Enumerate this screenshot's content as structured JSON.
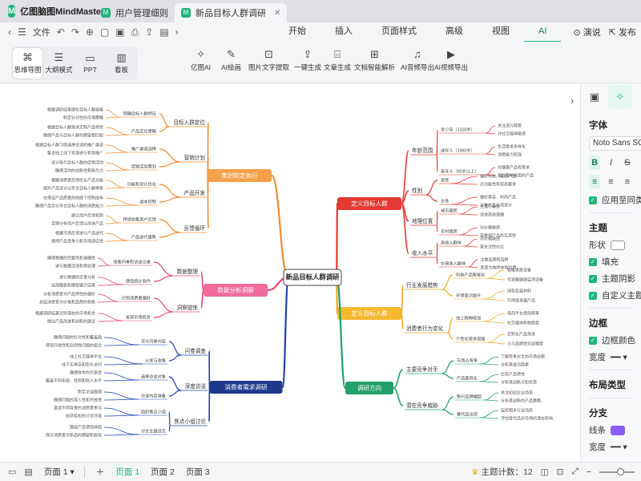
{
  "app": {
    "name": "亿图脑图MindMaster",
    "logo": "M"
  },
  "tabs": [
    {
      "label": "用户管理细则",
      "active": false
    },
    {
      "label": "新品目标人群调研",
      "active": true
    }
  ],
  "menubar": {
    "file_label": "文件",
    "tabs": [
      {
        "label": "开始",
        "active": false
      },
      {
        "label": "插入",
        "active": false
      },
      {
        "label": "页面样式",
        "active": false
      },
      {
        "label": "高级",
        "active": false
      },
      {
        "label": "视图",
        "active": false
      },
      {
        "label": "AI",
        "active": true
      }
    ],
    "present_label": "演说",
    "publish_label": "发布"
  },
  "toolbar": {
    "views": [
      {
        "label": "思维导图",
        "icon": "mindmap-icon",
        "glyph": "⌘",
        "active": true
      },
      {
        "label": "大纲模式",
        "icon": "outline-icon",
        "glyph": "☰",
        "active": false
      },
      {
        "label": "PPT",
        "icon": "ppt-icon",
        "glyph": "▭",
        "active": false
      },
      {
        "label": "看板",
        "icon": "kanban-icon",
        "glyph": "▥",
        "active": false
      }
    ],
    "ai_tools": [
      {
        "label": "亿图AI",
        "glyph": "✧"
      },
      {
        "label": "AI绘画",
        "glyph": "✎"
      },
      {
        "label": "图片文字提取",
        "glyph": "⊡"
      },
      {
        "label": "一键生成",
        "glyph": "⇪"
      },
      {
        "label": "文章生成",
        "glyph": "⌸"
      },
      {
        "label": "文档智能解析",
        "glyph": "⊞"
      },
      {
        "label": "AI音频导出",
        "glyph": "♫"
      },
      {
        "label": "AI视频导出",
        "glyph": "▶"
      }
    ]
  },
  "mindmap": {
    "root": "新品目标人群调研",
    "branches": [
      {
        "label": "定义目标人群",
        "color": "#e53935",
        "fill": "#e53935",
        "subs": [
          {
            "label": "年龄范围",
            "items": [
              "青少年（1318岁）",
              "成年人（1960岁）",
              "老年人（60岁以上）"
            ],
            "leaves": [
              [
                "关注流行趋势",
                "对社交媒体敏感"
              ],
              [
                "生活需求多样化",
                "消费能力较强"
              ],
              [
                "对健康产品有需求",
                "偏好简单易用的产品"
              ]
            ]
          },
          {
            "label": "性别",
            "items": [
              "男性",
              "女性"
            ],
            "leaves": [
              [
                "偏好科技、运动产品",
                "对功能性有较高要求"
              ],
              [
                "偏好美容、时尚产品",
                "注重产品外观设计"
              ]
            ]
          },
          {
            "label": "地理位置",
            "items": [
              "城市居民",
              "农村居民"
            ],
            "leaves": [
              [
                "生活节奏快",
                "追求高效便捷"
              ],
              [
                "对价格敏感",
                "更重视产品的实用性"
              ]
            ]
          },
          {
            "label": "收入水平",
            "items": [
              "高收入群体",
              "中高收入群体"
            ],
            "leaves": [
              [
                "对价格敏感",
                "更关注性价比"
              ],
              [
                "注重品质和品牌",
                "愿意为独特体验付费"
              ]
            ]
          }
        ]
      },
      {
        "label": "定义目标人群",
        "color": "#f5a623",
        "fill": "#f5b82e",
        "subs": [
          {
            "label": "行业发展趋势",
            "items": [
              "科技产品智能化",
              "环保意识提升"
            ],
            "leaves": [
              [
                "智能家居设备",
                "可穿戴健康监测设备"
              ],
              [
                "绿色包装材料",
                "可持续发展产品"
              ]
            ]
          },
          {
            "label": "消费者行为变化",
            "items": [
              "线上购物增加",
              "个性化需求增强"
            ],
            "leaves": [
              [
                "电商平台使用频率",
                "社交媒体购物趋势"
              ],
              [
                "定制化产品需求",
                "小众品牌受欢迎程度"
              ]
            ]
          }
        ]
      },
      {
        "label": "调研方向",
        "color": "#22a06b",
        "fill": "#22a06b",
        "subs": [
          {
            "label": "主要竞争对手",
            "items": [
              "市场占有率",
              "产品差异化"
            ],
            "leaves": [
              [
                "了解竞争对手的市场份额",
                "分析其成功因素"
              ],
              [
                "比较产品特性",
                "分析其创新点和优势"
              ]
            ]
          },
          {
            "label": "潜在竞争威胁",
            "items": [
              "新兴品牌崛起",
              "替代品出现"
            ],
            "leaves": [
              [
                "关注初创企业动态",
                "分析其创新的产品策略"
              ],
              [
                "监控相关行业动态",
                "评估替代品对市场的潜在影响"
              ]
            ]
          }
        ]
      },
      {
        "label": "策划制定执行",
        "color": "#f08c2e",
        "fill": "#f5a04a",
        "subs": [
          {
            "label": "目标人群定位",
            "items": [
              "明确目标人群特征",
              "产品定位策略"
            ],
            "leaves": [
              [
                "根据调研结果细化目标人群画像",
                "制定针对性的市场策略"
              ],
              [
                "根据目标人群需求定制产品特性",
                "确保产品与目标人群的期望相匹配"
              ]
            ]
          },
          {
            "label": "营销计划",
            "items": [
              "推广渠道选择",
              "促销活动策划"
            ],
            "leaves": [
              [
                "根据目标人群习惯选择合适的推广渠道",
                "整合线上线下资源进行有效推广"
              ],
              [
                "设计吸引目标人群的促销活动",
                "确保活动的创新性和吸引力"
              ]
            ]
          },
          {
            "label": "产品开发",
            "items": [
              "功能和设计优化",
              "成本控制"
            ],
            "leaves": [
              [
                "根据消费者反馈优化产品功能",
                "提升产品设计以符合目标人群审美"
              ],
              [
                "在保证产品质量的前提下控制成本",
                "确保产品定价符合目标人群的消费能力"
              ]
            ]
          },
          {
            "label": "反馈循环",
            "items": [
              "持续收集用户反馈",
              "产品迭代更新"
            ],
            "leaves": [
              [
                "建立用户反馈机制",
                "定期分析用户反馈以改进产品"
              ],
              [
                "根据市场反馈进行产品迭代",
                "保持产品竞争力和市场适应性"
              ]
            ]
          }
        ]
      },
      {
        "label": "数据分析洞察",
        "color": "#e0457b",
        "fill": "#f06a9a",
        "subs": [
          {
            "label": "数据整理",
            "items": [
              "收集问卷和访谈记录",
              "使用统计软件"
            ],
            "leaves": [
              [
                "确保数据的完整性和准确性",
                "进行数据清洗和预处理"
              ],
              [
                "进行数据的定量分析",
                "运用图表和模型展示结果"
              ]
            ]
          },
          {
            "label": "洞察提炼",
            "items": [
              "识别消费者偏好",
              "发现市场机会"
            ],
            "leaves": [
              [
                "分析消费者对产品特性的偏好",
                "总结消费者对价格和品质的权衡"
              ],
              [
                "根据调研结果识别潜在的市场机会",
                "提出产品改进和创新的建议"
              ]
            ]
          }
        ]
      },
      {
        "label": "消费者需求调研",
        "color": "#1e40af",
        "fill": "#1e3a8a",
        "subs": [
          {
            "label": "问卷调查",
            "items": [
              "设计问卷内容",
              "分发与收集"
            ],
            "leaves": [
              [
                "确保问题的针对性和覆盖面",
                "使用开放性和封闭性问题的组合"
              ],
              [
                "线上社交媒体平台",
                "线下实体店和街头访问"
              ]
            ]
          },
          {
            "label": "深度访谈",
            "items": [
              "选择访谈对象",
              "访谈内容准备"
            ],
            "leaves": [
              [
                "确保样本的代表性",
                "覆盖不同年龄、性别和收入水平"
              ],
              [
                "制定访谈提纲",
                "确保问题的深入性和开放性"
              ]
            ]
          },
          {
            "label": "焦点小组讨论",
            "items": [
              "组织焦点小组",
              "讨论主题设定"
            ],
            "leaves": [
              [
                "邀请不同背景的消费者参与",
                "创造轻松的讨论环境"
              ],
              [
                "围绕产品使用体验",
                "探讨消费者对新品的期望和担忧"
              ]
            ]
          }
        ]
      }
    ]
  },
  "panel": {
    "font_heading": "字体",
    "font_name": "Noto Sans SC",
    "bold_glyph": "B",
    "italic_glyph": "I",
    "strike_glyph": "S",
    "apply_same_label": "应用至同类型主",
    "theme_heading": "主题",
    "shape_label": "形状",
    "fill_label": "填充",
    "shadow_label": "主题阴影",
    "custom_width_label": "自定义主题宽度",
    "border_heading": "边框",
    "border_color_label": "边框颜色",
    "width_label": "宽度",
    "layout_heading": "布局类型",
    "branch_heading": "分支",
    "line_label": "线条",
    "branch_width_label": "宽度",
    "branch_color": "#8b5cf6"
  },
  "statusbar": {
    "pages_left": "页面 1",
    "pages": [
      {
        "label": "页面 1",
        "active": true
      },
      {
        "label": "页面 2",
        "active": false
      },
      {
        "label": "页面 3",
        "active": false
      }
    ],
    "topic_count_label": "主题计数：12"
  }
}
